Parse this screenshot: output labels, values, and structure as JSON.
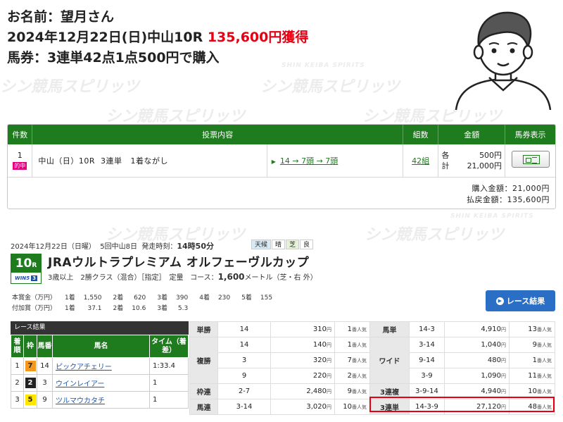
{
  "watermark": {
    "brand_jp": "シン競馬スピリッツ",
    "brand_en": "SHIN KEIBA SPIRITS"
  },
  "info": {
    "name_line": "お名前：望月さん",
    "race_line": "2024年12月22日(日)中山10R",
    "amount": "135,600円獲得",
    "ticket_line": "馬券：3連単42点1点500円で購入"
  },
  "ticket": {
    "headers": {
      "count": "件数",
      "content": "投票内容",
      "combos": "組数",
      "amount": "金額",
      "view": "馬券表示"
    },
    "row": {
      "num": "1",
      "hit_badge": "的中",
      "race": "中山（日）10R",
      "bet_type": "3連単",
      "method": "1着ながし",
      "horses": "14 → 7頭 → 7頭",
      "combos": "42組",
      "each_label": "各",
      "each_value": "500円",
      "total_label": "計",
      "total_value": "21,000円"
    },
    "purchase": "購入金額：21,000円",
    "refund": "払戻金額：135,600円"
  },
  "race": {
    "date": "2024年12月22日（日曜）",
    "meeting": "5回中山8日",
    "post_label": "発走時刻：",
    "post_time": "14時50分",
    "weather_label": "天候",
    "weather": "晴",
    "turf_label": "芝",
    "going": "良",
    "race_no": "10",
    "race_no_suffix": "R",
    "win5_label": "WIN5",
    "win5_no": "3",
    "name": "JRAウルトラプレミアム オルフェーヴルカップ",
    "conditions": "3歳以上　2勝クラス（混合）［指定］　定量",
    "course_label": "コース：",
    "course_dist": "1,600",
    "course_unit": "メートル（芝・右 外）",
    "prize_rows": [
      {
        "label": "本賞金（万円）",
        "cells": [
          "1着",
          "1,550",
          "2着",
          "620",
          "3着",
          "390",
          "4着",
          "230",
          "5着",
          "155"
        ]
      },
      {
        "label": "付加賞（万円）",
        "cells": [
          "1着",
          "37.1",
          "2着",
          "10.6",
          "3着",
          "5.3"
        ]
      }
    ],
    "result_button": "レース結果"
  },
  "results": {
    "title": "レース結果",
    "headers": [
      "着順",
      "枠",
      "馬番",
      "馬名",
      "タイム（着差）"
    ],
    "rows": [
      {
        "pos": "1",
        "waku": "7",
        "num": "14",
        "name": "ピックアチェリー",
        "time": "1:33.4"
      },
      {
        "pos": "2",
        "waku": "2",
        "num": "3",
        "name": "ウインレイアー",
        "time": "1"
      },
      {
        "pos": "3",
        "waku": "5",
        "num": "9",
        "name": "ツルマウカタチ",
        "time": "1"
      }
    ],
    "waku_colors": {
      "7": "#f39a1e",
      "2": "#222222",
      "5": "#ffe500"
    }
  },
  "payouts": {
    "left": [
      {
        "type": "単勝",
        "combo": "14",
        "yen": "310",
        "pop": "1"
      },
      {
        "type": "複勝",
        "combo": "14",
        "yen": "140",
        "pop": "1"
      },
      {
        "type": "",
        "combo": "3",
        "yen": "320",
        "pop": "7"
      },
      {
        "type": "",
        "combo": "9",
        "yen": "220",
        "pop": "2"
      },
      {
        "type": "枠連",
        "combo": "2-7",
        "yen": "2,480",
        "pop": "9"
      },
      {
        "type": "馬連",
        "combo": "3-14",
        "yen": "3,020",
        "pop": "10"
      }
    ],
    "right": [
      {
        "type": "馬単",
        "combo": "14-3",
        "yen": "4,910",
        "pop": "13"
      },
      {
        "type": "ワイド",
        "combo": "3-14",
        "yen": "1,040",
        "pop": "9"
      },
      {
        "type": "",
        "combo": "9-14",
        "yen": "480",
        "pop": "1"
      },
      {
        "type": "",
        "combo": "3-9",
        "yen": "1,090",
        "pop": "11"
      },
      {
        "type": "3連複",
        "combo": "3-9-14",
        "yen": "4,940",
        "pop": "10"
      },
      {
        "type": "3連単",
        "combo": "14-3-9",
        "yen": "27,120",
        "pop": "48"
      }
    ],
    "yen_unit": "円",
    "pop_unit": "番人気"
  },
  "colors": {
    "green": "#1e7b1e",
    "red": "#e60012",
    "blue": "#2a6ec6"
  }
}
